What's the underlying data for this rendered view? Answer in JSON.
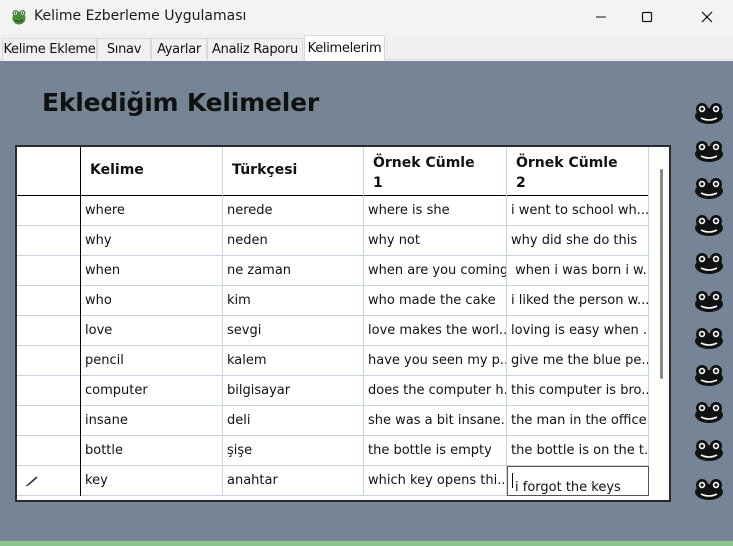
{
  "window": {
    "title": "Kelime Ezberleme Uygulaması",
    "icon": "frog-app-icon",
    "controls": [
      "minimize-icon",
      "maximize-icon",
      "close-icon"
    ]
  },
  "tabs": [
    {
      "label": "Kelime Ekleme",
      "active": false
    },
    {
      "label": "Sınav",
      "active": false
    },
    {
      "label": "Ayarlar",
      "active": false
    },
    {
      "label": "Analiz Raporu",
      "active": false
    },
    {
      "label": "Kelimelerim",
      "active": true
    }
  ],
  "page": {
    "heading": "Eklediğim Kelimeler"
  },
  "grid": {
    "columns": [
      "",
      "Kelime",
      "Türkçesi",
      "Örnek Cümle\n1",
      "Örnek Cümle\n2"
    ],
    "rows": [
      [
        "",
        "where",
        "nerede",
        "where is she",
        "i went to school wh..."
      ],
      [
        "",
        "why",
        "neden",
        "why not",
        "why did she do this"
      ],
      [
        "",
        "when",
        "ne zaman",
        "when are you coming",
        " when i was born i w..."
      ],
      [
        "",
        "who",
        "kim",
        "who made the cake",
        "i liked the person w..."
      ],
      [
        "",
        "love",
        "sevgi",
        "love makes the worl...",
        "loving is easy when ..."
      ],
      [
        "",
        "pencil",
        "kalem",
        "have you seen my p...",
        "give me the blue pe..."
      ],
      [
        "",
        "computer",
        "bilgisayar",
        "does the computer h...",
        "this computer is bro..."
      ],
      [
        "",
        "insane",
        "deli",
        "she was a bit insane...",
        "the man in the office..."
      ],
      [
        "",
        "bottle",
        "şişe",
        "the bottle is empty",
        "the bottle is on the t..."
      ],
      [
        "",
        "key",
        "anahtar",
        "which key opens thi...",
        "i forgot the keys"
      ]
    ],
    "editing_row_indicator": "pencil-icon"
  },
  "side_icons": [
    "frog-icon",
    "frog-icon",
    "frog-icon",
    "frog-icon",
    "frog-icon",
    "frog-icon",
    "frog-icon",
    "frog-icon",
    "frog-icon",
    "frog-icon",
    "frog-icon"
  ],
  "colors": {
    "content_bg": "#758596",
    "grid_line": "#c9d4e3",
    "bottom_strip": "#8cc68c"
  }
}
